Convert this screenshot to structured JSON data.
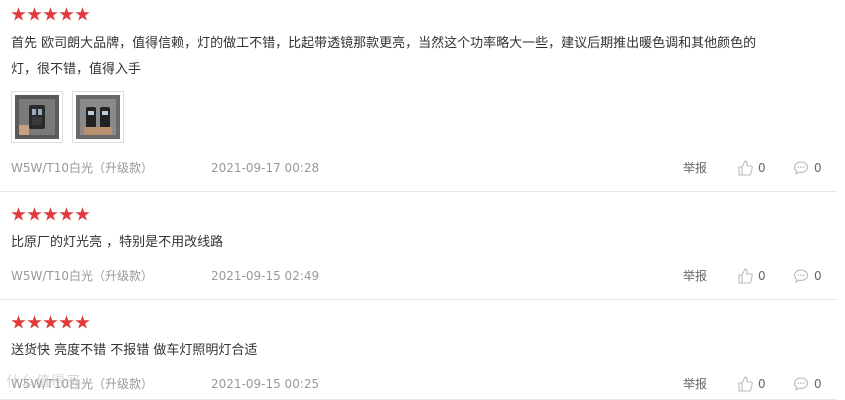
{
  "reviews": [
    {
      "rating": 5,
      "text_line1": "首先 欧司朗大品牌，值得信赖，灯的做工不错，比起带透镜那款更亮，当然这个功率略大一些，建议后期推出暖色调和其他颜色的",
      "text_line2": "灯，很不错，值得入手",
      "photos": [
        "photo-bulb-1",
        "photo-bulb-2"
      ],
      "spec": "W5W/T10白光（升级款）",
      "date": "2021-09-17 00:28",
      "report_label": "举报",
      "like_count": "0",
      "reply_count": "0"
    },
    {
      "rating": 5,
      "text_line1": "比原厂的灯光亮 ，特别是不用改线路",
      "spec": "W5W/T10白光（升级款）",
      "date": "2021-09-15 02:49",
      "report_label": "举报",
      "like_count": "0",
      "reply_count": "0"
    },
    {
      "rating": 5,
      "text_line1": "送货快 亮度不错 不报错 做车灯照明灯合适",
      "spec": "W5W/T10白光（升级款）",
      "date": "2021-09-15 00:25",
      "report_label": "举报",
      "like_count": "0",
      "reply_count": "0"
    }
  ],
  "watermark": "什么值得买",
  "colors": {
    "star": "#e2393c",
    "meta_text": "#999999",
    "divider": "#e6e6e6"
  }
}
